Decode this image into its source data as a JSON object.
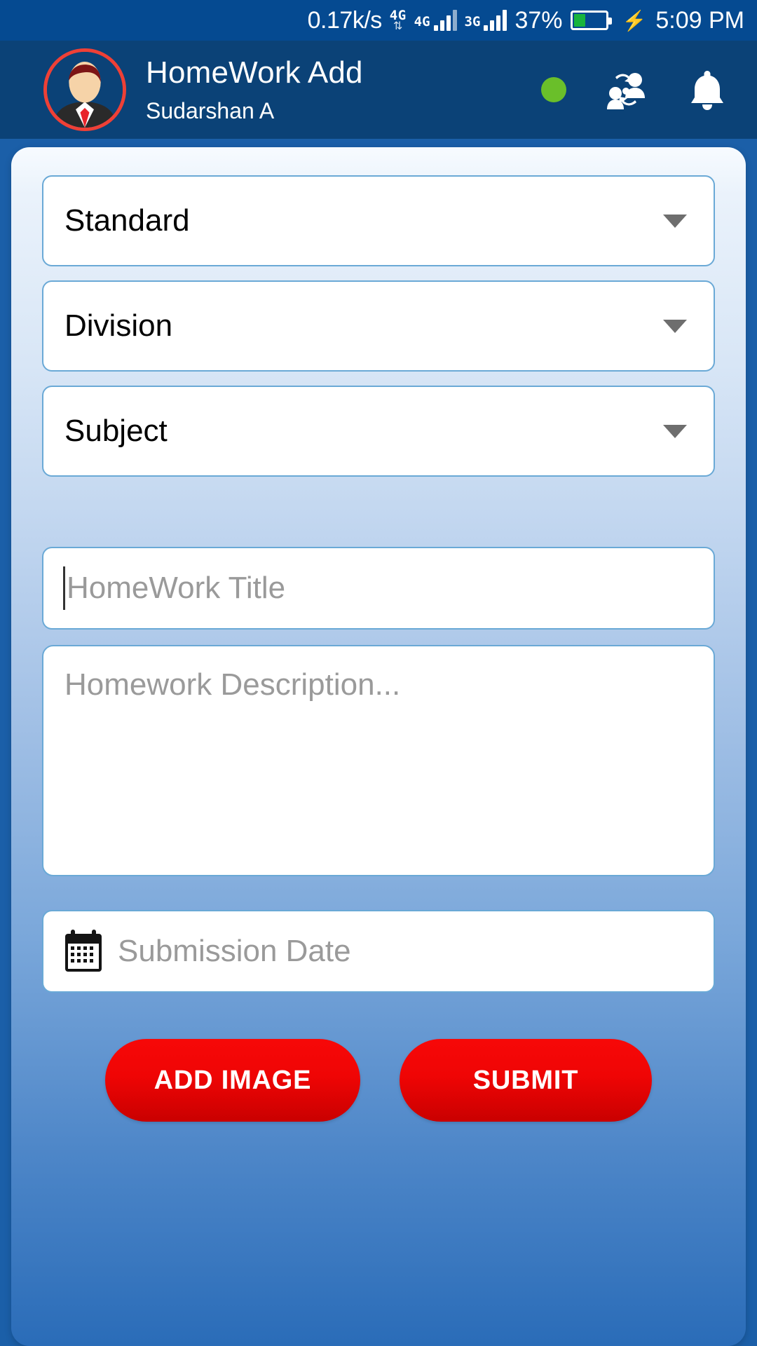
{
  "status_bar": {
    "network_speed": "0.17k/s",
    "sim1_type": "4G",
    "sim1_label": "4G",
    "sim2_label": "3G",
    "battery_percent": "37%",
    "time": "5:09 PM",
    "charging_icon": "bolt-icon",
    "data_arrows_icon": "data-transfer-arrows-icon",
    "colors": {
      "bar_bg": "#054a91",
      "battery_fill": "#18b43c"
    }
  },
  "app_bar": {
    "title": "HomeWork Add",
    "subtitle": "Sudarshan A",
    "avatar_icon": "user-avatar-icon",
    "avatar_ring_color": "#ef4036",
    "online_dot_color": "#6abf2a",
    "switch_user_icon": "switch-user-icon",
    "notification_icon": "bell-icon",
    "bg_color": "#0b4277"
  },
  "form": {
    "selects": [
      {
        "label": "Standard",
        "icon": "chevron-down-icon"
      },
      {
        "label": "Division",
        "icon": "chevron-down-icon"
      },
      {
        "label": "Subject",
        "icon": "chevron-down-icon"
      }
    ],
    "title_input": {
      "value": "",
      "placeholder": "HomeWork Title",
      "focused": true
    },
    "description_input": {
      "value": "",
      "placeholder": "Homework Description..."
    },
    "date_input": {
      "value": "",
      "placeholder": "Submission Date",
      "icon": "calendar-icon"
    },
    "buttons": {
      "add_image": "ADD IMAGE",
      "submit": "SUBMIT",
      "color": "#ef0505"
    }
  }
}
